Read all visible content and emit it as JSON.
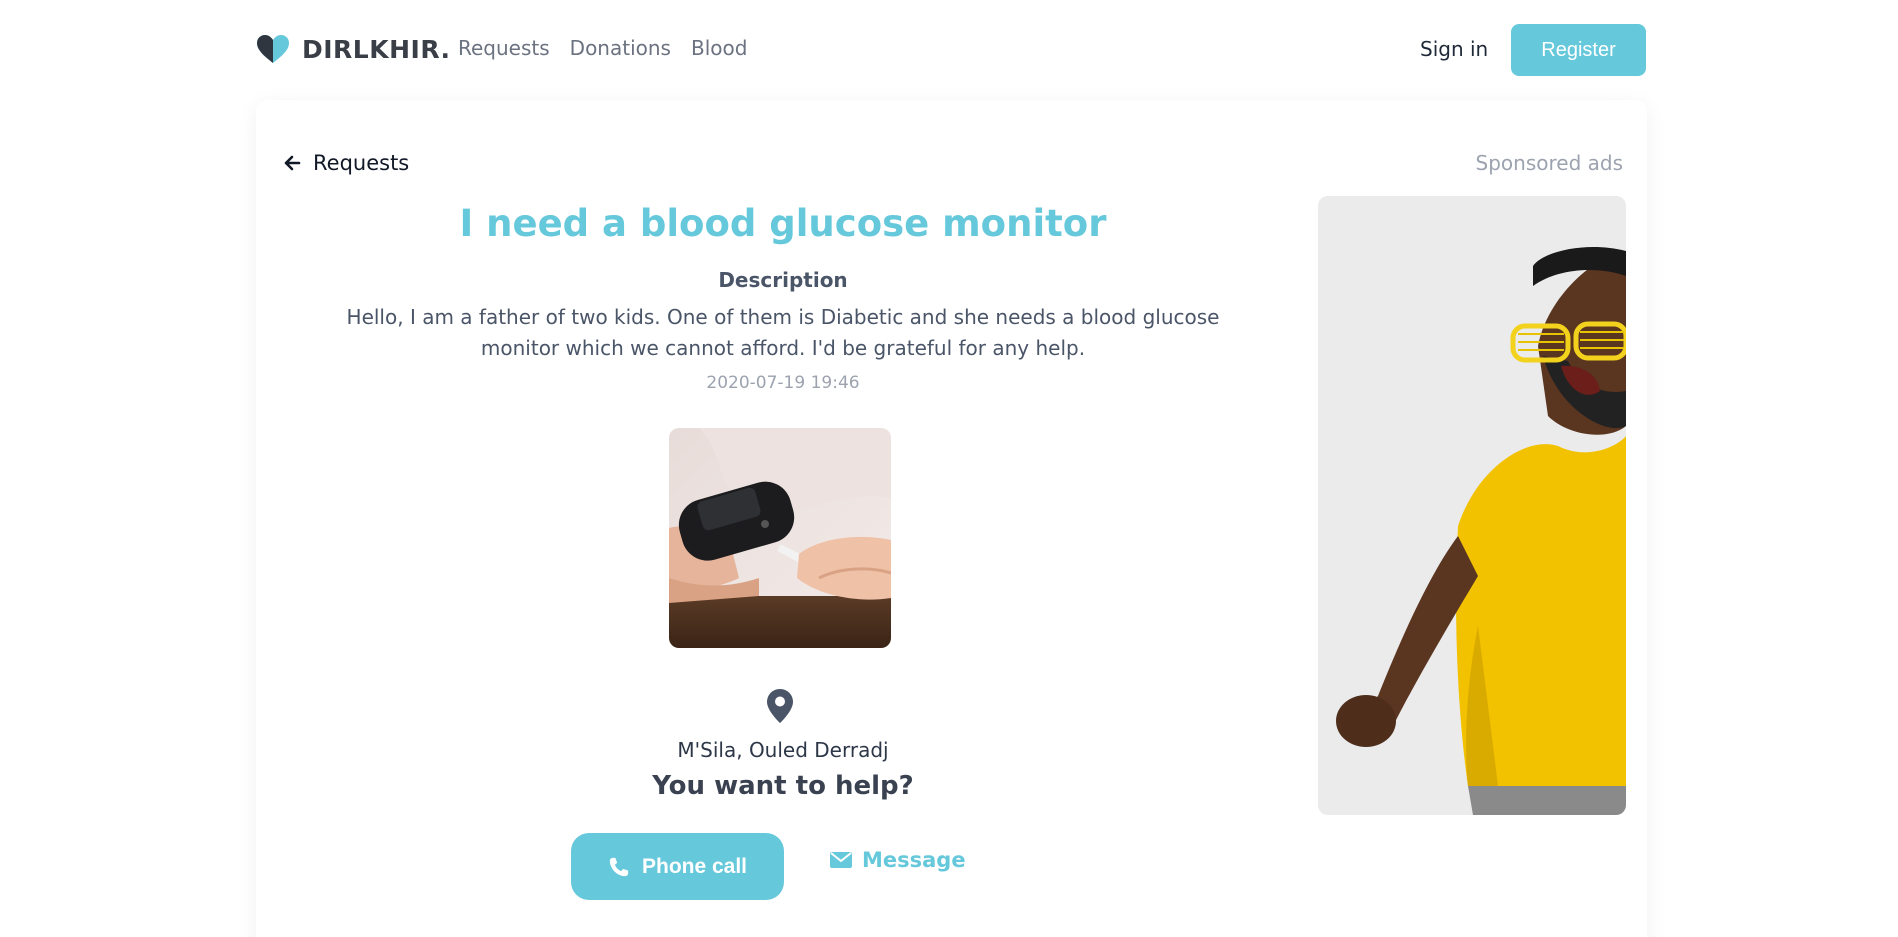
{
  "header": {
    "brand": "DIRLKHIR.",
    "nav": [
      "Requests",
      "Donations",
      "Blood"
    ],
    "signin_label": "Sign in",
    "register_label": "Register"
  },
  "back_label": "Requests",
  "sponsored_label": "Sponsored ads",
  "request": {
    "title": "I need a blood glucose monitor",
    "description_label": "Description",
    "description": "Hello, I am a father of two kids. One of them is Diabetic and she needs a blood glucose monitor which we cannot afford. I'd be grateful for any help.",
    "date": "2020-07-19 19:46",
    "location": "M'Sila, Ouled Derradj"
  },
  "help": {
    "question": "You want to help?",
    "phone_label": "Phone call",
    "message_label": "Message"
  },
  "icons": {
    "logo": "heart-icon",
    "back": "arrow-left-icon",
    "location": "map-pin-icon",
    "phone": "phone-icon",
    "message": "envelope-icon"
  },
  "colors": {
    "accent": "#66c8db",
    "text": "#4a5568",
    "muted": "#9ca3af"
  }
}
